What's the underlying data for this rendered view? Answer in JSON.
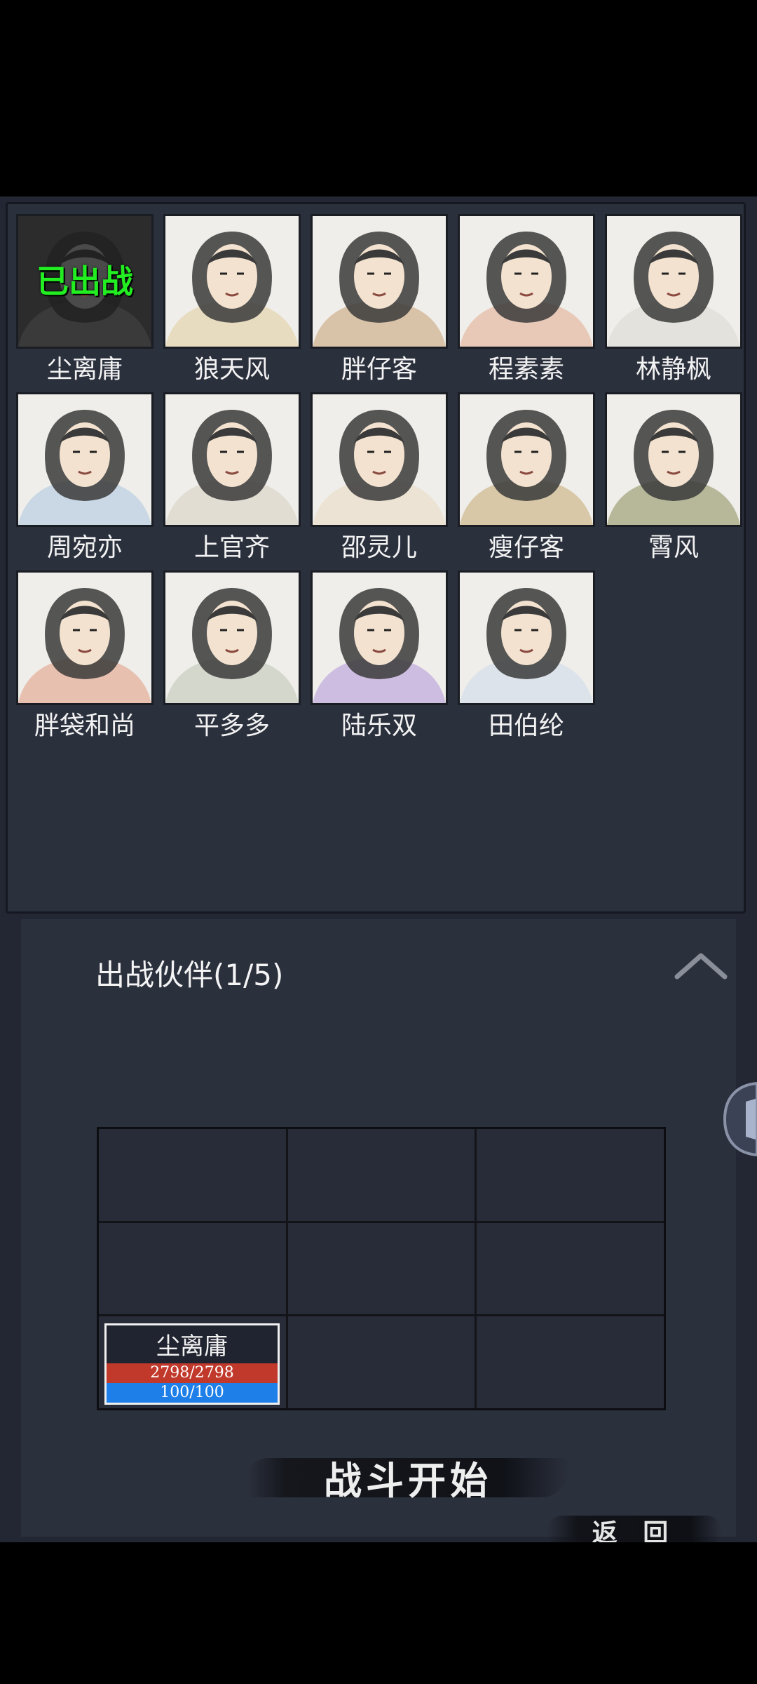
{
  "roster": [
    {
      "name": "尘离庸",
      "deployed": true,
      "badge": "已出战",
      "tint": "#3a3a3a"
    },
    {
      "name": "狼天风",
      "deployed": false,
      "tint": "#e8dcc0"
    },
    {
      "name": "胖仔客",
      "deployed": false,
      "tint": "#d9c3a8"
    },
    {
      "name": "程素素",
      "deployed": false,
      "tint": "#e8c9b8"
    },
    {
      "name": "林静枫",
      "deployed": false,
      "tint": "#e4e2dc"
    },
    {
      "name": "周宛亦",
      "deployed": false,
      "tint": "#c9d8e4"
    },
    {
      "name": "上官齐",
      "deployed": false,
      "tint": "#e2ddd2"
    },
    {
      "name": "邵灵儿",
      "deployed": false,
      "tint": "#ece3d4"
    },
    {
      "name": "瘦仔客",
      "deployed": false,
      "tint": "#d8c8a8"
    },
    {
      "name": "霄风",
      "deployed": false,
      "tint": "#b7b89a"
    },
    {
      "name": "胖袋和尚",
      "deployed": false,
      "tint": "#e8c0b0"
    },
    {
      "name": "平多多",
      "deployed": false,
      "tint": "#d4d7cc"
    },
    {
      "name": "陆乐双",
      "deployed": false,
      "tint": "#cdbde0"
    },
    {
      "name": "田伯纶",
      "deployed": false,
      "tint": "#dde3ea"
    }
  ],
  "party": {
    "title": "出战伙伴(1/5)",
    "units": [
      {
        "slot": 6,
        "name": "尘离庸",
        "hp": "2798/2798",
        "mp": "100/100"
      }
    ]
  },
  "buttons": {
    "start": "战斗开始",
    "back": "返 回"
  },
  "colors": {
    "panel": "#2b303d",
    "deployed_text": "#22ee22",
    "hp_bar": "#c0392b",
    "mp_bar": "#1f7fe8"
  }
}
